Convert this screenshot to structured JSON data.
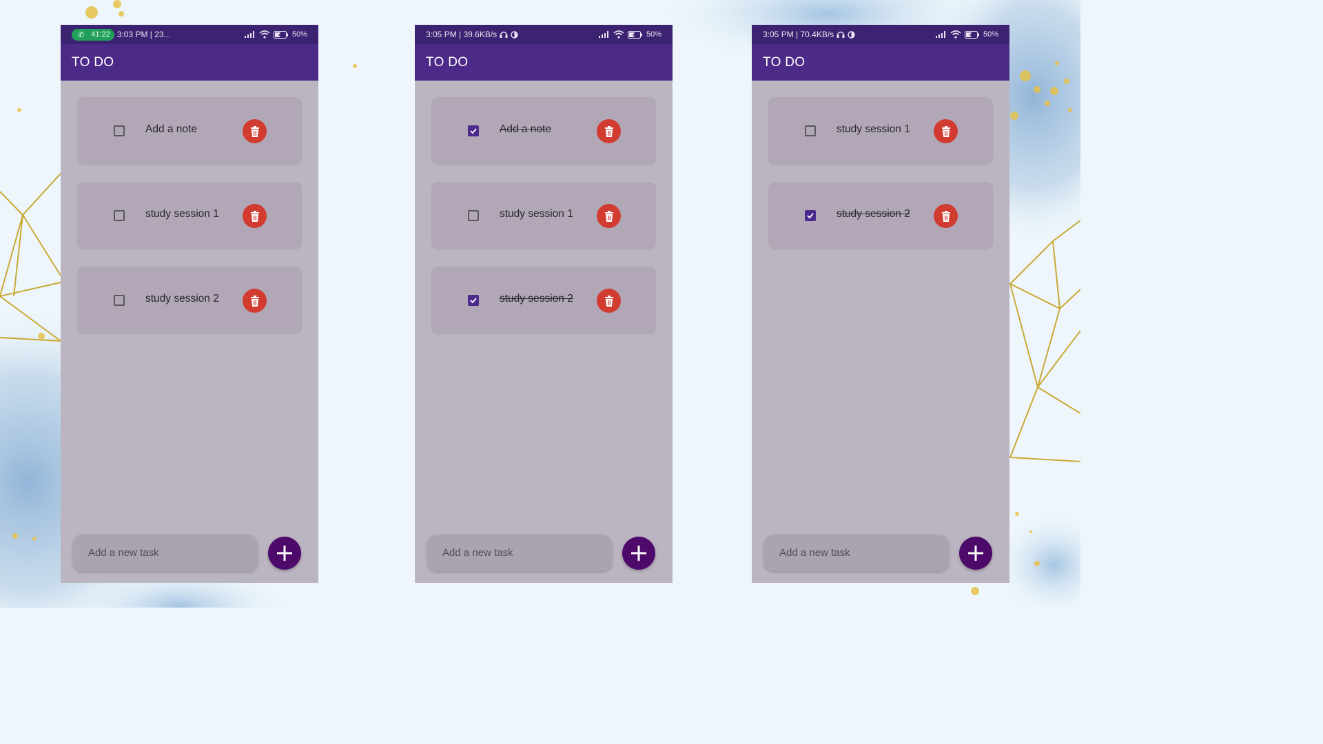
{
  "colors": {
    "status_bar": "#3c2372",
    "app_bar": "#4c2a87",
    "screen_bg": "#bbb4c1",
    "task_card": "#b1a7b7",
    "delete": "#d23b30",
    "fab": "#4d0a6b",
    "checkbox_checked": "#4b2a8c",
    "call_pill": "#22a05a"
  },
  "phones": [
    {
      "status": {
        "call_timer": "41:22",
        "left_text": "3:03 PM | 23...",
        "battery": "50%"
      },
      "app_title": "TO DO",
      "tasks": [
        {
          "label": "Add a note",
          "checked": false
        },
        {
          "label": "study session 1",
          "checked": false
        },
        {
          "label": "study session 2",
          "checked": false
        }
      ],
      "input_placeholder": "Add a new task"
    },
    {
      "status": {
        "left_text": "3:05 PM | 39.6KB/s",
        "battery": "50%"
      },
      "app_title": "TO DO",
      "tasks": [
        {
          "label": "Add a note",
          "checked": true
        },
        {
          "label": "study session 1",
          "checked": false
        },
        {
          "label": "study session 2",
          "checked": true
        }
      ],
      "input_placeholder": "Add a new task"
    },
    {
      "status": {
        "left_text": "3:05 PM | 70.4KB/s",
        "battery": "50%"
      },
      "app_title": "TO DO",
      "tasks": [
        {
          "label": "study session 1",
          "checked": false
        },
        {
          "label": "study session 2",
          "checked": true
        }
      ],
      "input_placeholder": "Add a new task"
    }
  ]
}
